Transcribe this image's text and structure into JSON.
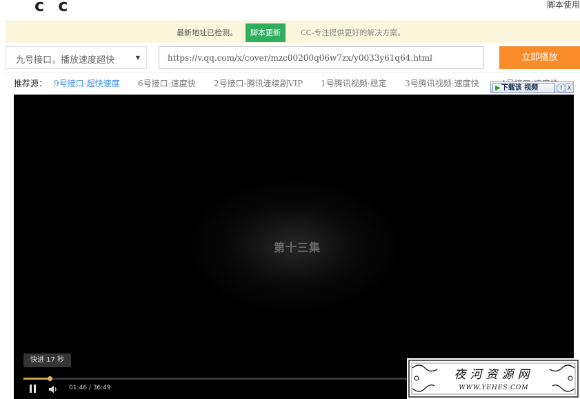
{
  "header": {
    "logo_chars": [
      "c",
      "c"
    ],
    "usage_link": "脚本使用"
  },
  "notice": {
    "text": "最新地址已检测。",
    "update_button": "脚本更新",
    "slogan": "CC-专注提供更好的解决方案。"
  },
  "controls": {
    "interface_select": "九号接口，播放速度超快",
    "url_value": "https://v.qq.com/x/cover/mzc00200q06w7zx/y0033y61q64.html",
    "play_button": "立即播放"
  },
  "sources": {
    "label": "推荐源：",
    "items": [
      {
        "label": "9号接口-超快速度",
        "active": true
      },
      {
        "label": "6号接口-速度快",
        "active": false
      },
      {
        "label": "2号接口-腾讯连续剧VIP",
        "active": false
      },
      {
        "label": "1号腾讯视频-稳定",
        "active": false
      },
      {
        "label": "3号腾讯视频-速度快",
        "active": false
      },
      {
        "label": "4号接口-速度快",
        "active": false
      }
    ]
  },
  "download_widget": {
    "label": "下载该 视频",
    "help": "?",
    "close": "X"
  },
  "player": {
    "episode_title": "第十三集",
    "seek_toast": "快进 17 秒",
    "current_time": "01:46",
    "duration": "36:49",
    "time_display": "01:46 / 36:49",
    "progress_fraction": 0.048
  },
  "watermark": {
    "title": "夜河资源网",
    "url": "WWW.YEHES.COM"
  },
  "colors": {
    "update_green": "#2fae5f",
    "play_orange": "#f98c29",
    "active_source_blue": "#3d8ee8",
    "notice_bg": "#fcf6dc",
    "progress_gold": "#d2a24b"
  }
}
